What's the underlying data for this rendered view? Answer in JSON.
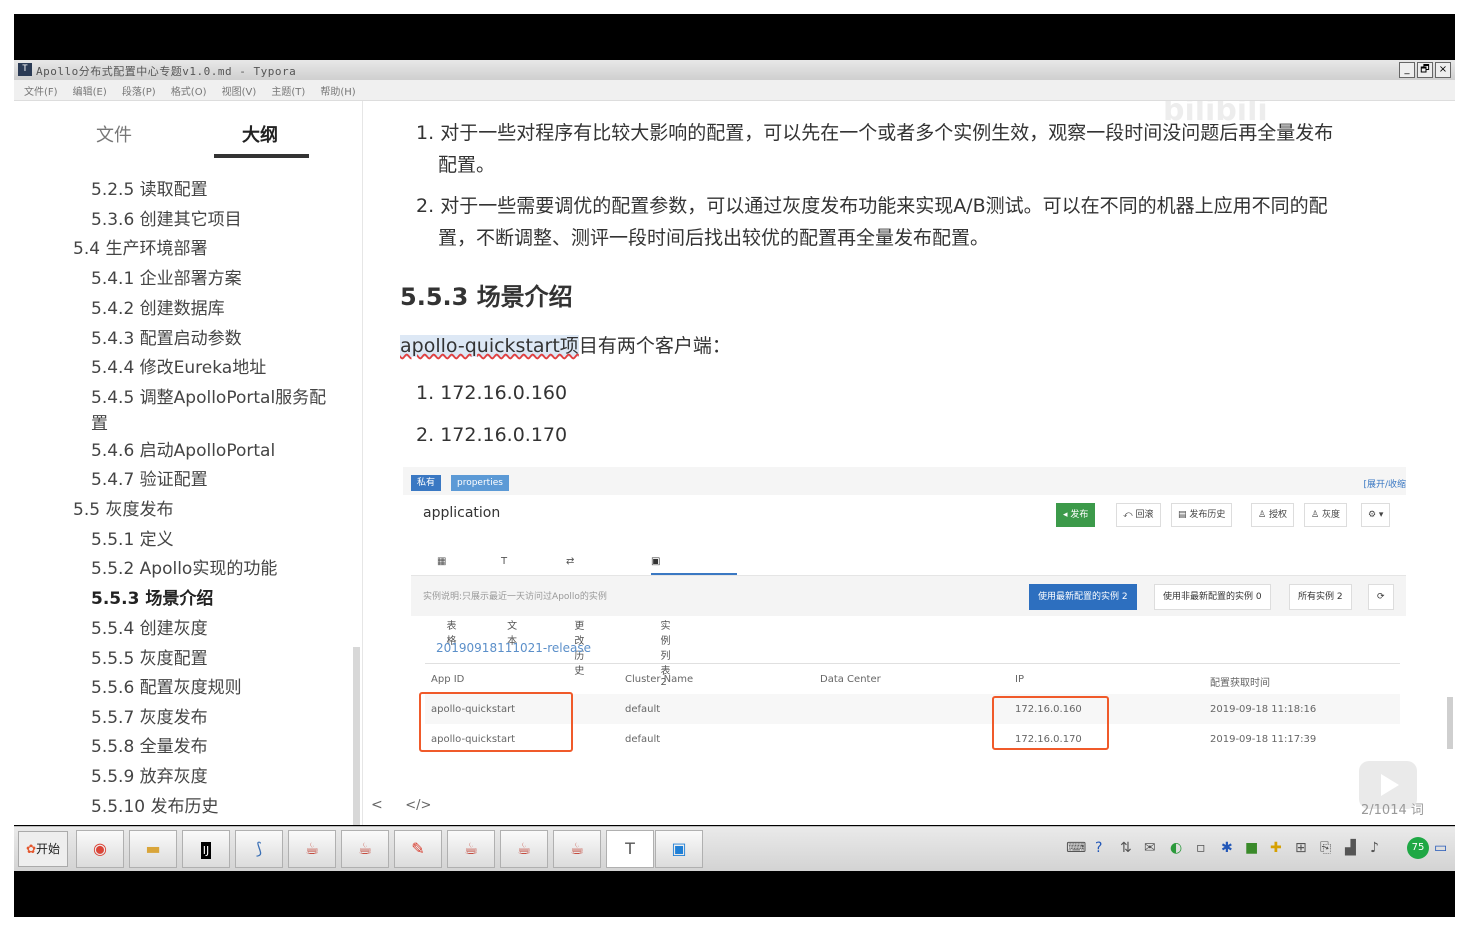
{
  "window": {
    "title": "Apollo分布式配置中心专题v1.0.md - Typora",
    "app_icon": "T",
    "controls": [
      "_",
      "🗗",
      "×"
    ]
  },
  "menu": [
    "文件(F)",
    "编辑(E)",
    "段落(P)",
    "格式(O)",
    "视图(V)",
    "主题(T)",
    "帮助(H)"
  ],
  "sidebar": {
    "tabs": [
      "文件",
      "大纲"
    ],
    "outline": [
      {
        "label": "5.2.5 读取配置"
      },
      {
        "label": "5.3.6 创建其它项目"
      },
      {
        "label": "5.4 生产环境部署"
      },
      {
        "label": "5.4.1 企业部署方案"
      },
      {
        "label": "5.4.2 创建数据库"
      },
      {
        "label": "5.4.3 配置启动参数"
      },
      {
        "label": "5.4.4 修改Eureka地址"
      },
      {
        "label": "5.4.5 调整ApolloPortal服务配置"
      },
      {
        "label": "5.4.6 启动ApolloPortal"
      },
      {
        "label": "5.4.7 验证配置"
      },
      {
        "label": "5.5 灰度发布"
      },
      {
        "label": "5.5.1 定义"
      },
      {
        "label": "5.5.2 Apollo实现的功能"
      },
      {
        "label": "5.5.3 场景介绍"
      },
      {
        "label": "5.5.4 创建灰度"
      },
      {
        "label": "5.5.5 灰度配置"
      },
      {
        "label": "5.5.6 配置灰度规则"
      },
      {
        "label": "5.5.7 灰度发布"
      },
      {
        "label": "5.5.8 全量发布"
      },
      {
        "label": "5.5.9 放弃灰度"
      },
      {
        "label": "5.5.10 发布历史"
      }
    ]
  },
  "content": {
    "list1": [
      {
        "num": "1.",
        "text": "对于一些对程序有比较大影响的配置，可以先在一个或者多个实例生效，观察一段时间没问题后再全量发布",
        "cont": "配置。"
      },
      {
        "num": "2.",
        "text": "对于一些需要调优的配置参数，可以通过灰度发布功能来实现A/B测试。可以在不同的机器上应用不同的配",
        "cont": "置，不断调整、测评一段时间后找出较优的配置再全量发布配置。"
      }
    ],
    "heading": "5.5.3 场景介绍",
    "intro_highlight": "apollo-quickstart项",
    "intro_rest": "目有两个客户端：",
    "clients": [
      {
        "num": "1.",
        "ip": "172.16.0.160"
      },
      {
        "num": "2.",
        "ip": "172.16.0.170"
      }
    ],
    "watermark": "bilibili"
  },
  "embedded": {
    "badge_private": "私有",
    "badge_properties": "properties",
    "expand": "[展开/收缩",
    "app_name": "application",
    "buttons": {
      "publish": "发布",
      "rollback": "回滚",
      "history": "发布历史",
      "auth": "授权",
      "gray": "灰度",
      "settings": "⚙ ▾"
    },
    "subtabs": [
      "表格",
      "文本",
      "更改历史",
      "实例列表 2"
    ],
    "info": "实例说明:只展示最近一天访问过Apollo的实例",
    "filters": {
      "latest": "使用最新配置的实例 2",
      "non_latest": "使用非最新配置的实例 0",
      "all": "所有实例 2"
    },
    "release": "20190918111021-release",
    "columns": [
      "App ID",
      "Cluster Name",
      "Data Center",
      "IP",
      "配置获取时间"
    ],
    "rows": [
      [
        "apollo-quickstart",
        "default",
        "",
        "172.16.0.160",
        "2019-09-18 11:18:16"
      ],
      [
        "apollo-quickstart",
        "default",
        "",
        "172.16.0.170",
        "2019-09-18 11:17:39"
      ]
    ]
  },
  "footer": {
    "back": "<",
    "source": "</>",
    "wordcount": "2/1014 词"
  },
  "taskbar": {
    "start": "开始",
    "apps": [
      "chrome",
      "explorer",
      "intellij",
      "blue-app",
      "java",
      "java",
      "tool",
      "java",
      "java",
      "java",
      "typora",
      "vm"
    ],
    "tray_badge": "75"
  },
  "colors": {
    "accent": "#3a78c3",
    "highlight_box": "#f05a2a",
    "publish_green": "#3c9a4a"
  }
}
